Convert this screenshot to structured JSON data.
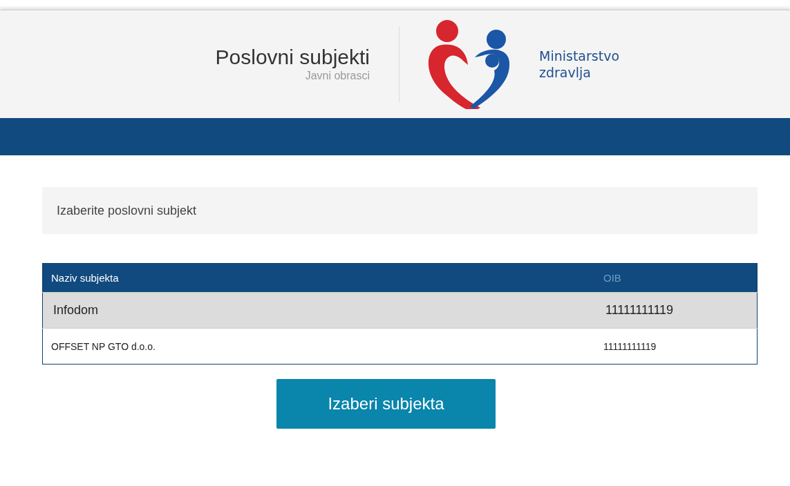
{
  "header": {
    "title": "Poslovni subjekti",
    "subtitle": "Javni obrasci",
    "ministry_lines": [
      "Ministarstvo",
      "zdravlja"
    ]
  },
  "prompt": "Izaberite poslovni subjekt",
  "table": {
    "columns": [
      "Naziv subjekta",
      "OIB"
    ],
    "rows": [
      {
        "cells": [
          "Infodom",
          "11111111119"
        ],
        "selected": true
      },
      {
        "cells": [
          "OFFSET NP GTO d.o.o.",
          "11111111119"
        ],
        "selected": false
      }
    ]
  },
  "button": "Izaberi subjekta"
}
